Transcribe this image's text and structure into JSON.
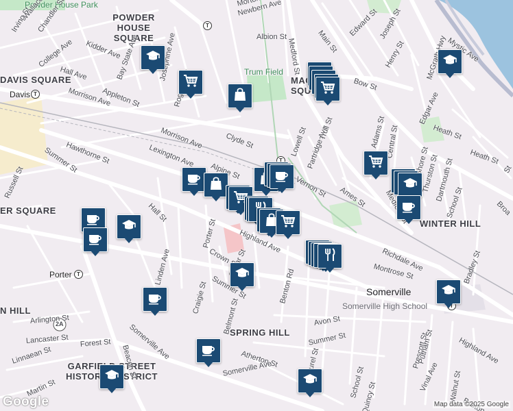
{
  "map": {
    "areas": [
      {
        "key": "powder-house-square",
        "text": "POWDER HOUSE SQUARE"
      },
      {
        "key": "davis-square",
        "text": "DAVIS SQUARE"
      },
      {
        "key": "union-square-partial",
        "text": "ER SQUARE"
      },
      {
        "key": "winter-hill",
        "text": "WINTER HILL"
      },
      {
        "key": "spring-hill",
        "text": "SPRING HILL"
      },
      {
        "key": "garfield",
        "text": "GARFIELD STREET HISTORIC DISTRICT"
      },
      {
        "key": "magoun-square",
        "text": "MAGOUN SQUARE"
      },
      {
        "key": "n-hill",
        "text": "N HILL"
      }
    ],
    "parks": [
      {
        "key": "powder-house-park",
        "text": "Powder House Park"
      },
      {
        "key": "trum-field",
        "text": "Trum Field"
      }
    ],
    "places": [
      {
        "key": "somerville",
        "text": "Somerville"
      },
      {
        "key": "somerville-high-school",
        "text": "Somerville High School"
      },
      {
        "key": "davis",
        "text": "Davis"
      },
      {
        "key": "porter",
        "text": "Porter"
      }
    ],
    "streets": [
      {
        "key": "irving",
        "text": "Irving St"
      },
      {
        "key": "chandler",
        "text": "Chandler St"
      },
      {
        "key": "wallace",
        "text": "Wallace St"
      },
      {
        "key": "college",
        "text": "College Ave"
      },
      {
        "key": "hall-ave",
        "text": "Hall Ave"
      },
      {
        "key": "kidder",
        "text": "Kidder Ave"
      },
      {
        "key": "bay-state",
        "text": "Bay State Ave"
      },
      {
        "key": "josephine",
        "text": "Josephine Ave"
      },
      {
        "key": "rogers",
        "text": "Rogers Ave"
      },
      {
        "key": "morrison-1",
        "text": "Morrison Ave"
      },
      {
        "key": "appleton",
        "text": "Appleton St"
      },
      {
        "key": "morrison-2",
        "text": "Morrison Ave"
      },
      {
        "key": "clyde",
        "text": "Clyde St"
      },
      {
        "key": "hawthorne",
        "text": "Hawthorne St"
      },
      {
        "key": "lexington",
        "text": "Lexington Ave"
      },
      {
        "key": "alpine",
        "text": "Alpine St"
      },
      {
        "key": "summer-1",
        "text": "Summer St"
      },
      {
        "key": "russell",
        "text": "Russell St"
      },
      {
        "key": "hall-st",
        "text": "Hall St"
      },
      {
        "key": "porter-st",
        "text": "Porter St"
      },
      {
        "key": "linden",
        "text": "Linden Ave"
      },
      {
        "key": "highland-1",
        "text": "Highland Ave"
      },
      {
        "key": "crown",
        "text": "Crown St"
      },
      {
        "key": "cedar",
        "text": "Cedar St"
      },
      {
        "key": "summer-2",
        "text": "Summer St"
      },
      {
        "key": "craigie",
        "text": "Craigie St"
      },
      {
        "key": "belmont",
        "text": "Belmont St"
      },
      {
        "key": "arlington",
        "text": "Arlington St"
      },
      {
        "key": "lancaster",
        "text": "Lancaster St"
      },
      {
        "key": "forest",
        "text": "Forest St"
      },
      {
        "key": "linnaean",
        "text": "Linnaean St"
      },
      {
        "key": "martin",
        "text": "Martin St"
      },
      {
        "key": "somerville-ave-1",
        "text": "Somerville Ave"
      },
      {
        "key": "beacon",
        "text": "Beacon St"
      },
      {
        "key": "atherton",
        "text": "Atherton St"
      },
      {
        "key": "somerville-ave-2",
        "text": "Somerville Ave"
      },
      {
        "key": "summer-3",
        "text": "Summer St"
      },
      {
        "key": "avon",
        "text": "Avon St"
      },
      {
        "key": "laurel",
        "text": "Laurel St"
      },
      {
        "key": "school-1",
        "text": "School St"
      },
      {
        "key": "quincy",
        "text": "Quincy St"
      },
      {
        "key": "benton",
        "text": "Benton Rd"
      },
      {
        "key": "montrose",
        "text": "Montrose St"
      },
      {
        "key": "richdale",
        "text": "Richdale Ave"
      },
      {
        "key": "prescott",
        "text": "Prescott St"
      },
      {
        "key": "putnam",
        "text": "Putnam St"
      },
      {
        "key": "vinal",
        "text": "Vinal Ave"
      },
      {
        "key": "walnut",
        "text": "Walnut St"
      },
      {
        "key": "boston",
        "text": "Boston St"
      },
      {
        "key": "highland-2",
        "text": "Highland Ave"
      },
      {
        "key": "bradley",
        "text": "Bradley St"
      },
      {
        "key": "school-2",
        "text": "School St"
      },
      {
        "key": "dartmouth",
        "text": "Dartmouth St"
      },
      {
        "key": "thurston",
        "text": "Thurston St"
      },
      {
        "key": "shore",
        "text": "Shore St"
      },
      {
        "key": "central",
        "text": "Central St"
      },
      {
        "key": "adams",
        "text": "Adams St"
      },
      {
        "key": "medford-1",
        "text": "Medford St"
      },
      {
        "key": "ames",
        "text": "Ames St"
      },
      {
        "key": "vernon",
        "text": "Vernon St"
      },
      {
        "key": "partridge",
        "text": "Partridge Ave"
      },
      {
        "key": "trull",
        "text": "Trull St"
      },
      {
        "key": "lowell",
        "text": "Lowell St"
      },
      {
        "key": "bow",
        "text": "Bow St"
      },
      {
        "key": "henry",
        "text": "Henry St"
      },
      {
        "key": "joseph",
        "text": "Joseph St"
      },
      {
        "key": "edward",
        "text": "Edward St"
      },
      {
        "key": "main",
        "text": "Main St"
      },
      {
        "key": "medford-2",
        "text": "Medford St"
      },
      {
        "key": "albion",
        "text": "Albion St"
      },
      {
        "key": "newbern",
        "text": "Newbern Ave"
      },
      {
        "key": "morton",
        "text": "Morton St"
      },
      {
        "key": "mystic",
        "text": "Mystic Ave"
      },
      {
        "key": "mcgrath",
        "text": "McGrath Hwy"
      },
      {
        "key": "edgar",
        "text": "Edgar Ave"
      },
      {
        "key": "heath-1",
        "text": "Heath St"
      },
      {
        "key": "heath-2",
        "text": "Heath St"
      },
      {
        "key": "broadway",
        "text": "Broa"
      },
      {
        "key": "st-edge",
        "text": "St"
      },
      {
        "key": "route-2a",
        "text": "2A"
      }
    ],
    "pins": [
      {
        "key": "school-1",
        "type": "school-icon"
      },
      {
        "key": "grocery-1",
        "type": "cart-icon"
      },
      {
        "key": "shop-1",
        "type": "bag-icon"
      },
      {
        "key": "grocery-cluster-magoun",
        "type": "cart-icon"
      },
      {
        "key": "school-2",
        "type": "school-icon"
      },
      {
        "key": "coffee-1",
        "type": "coffee-icon"
      },
      {
        "key": "shop-2",
        "type": "bag-icon"
      },
      {
        "key": "shop-3",
        "type": "bag-icon"
      },
      {
        "key": "coffee-2",
        "type": "coffee-icon"
      },
      {
        "key": "grocery-2",
        "type": "cart-icon"
      },
      {
        "key": "restaurant-1",
        "type": "restaurant-icon"
      },
      {
        "key": "shop-4",
        "type": "bag-icon"
      },
      {
        "key": "grocery-3",
        "type": "cart-icon"
      },
      {
        "key": "coffee-3",
        "type": "coffee-icon"
      },
      {
        "key": "school-3",
        "type": "school-icon"
      },
      {
        "key": "coffee-4",
        "type": "coffee-icon"
      },
      {
        "key": "restaurant-2",
        "type": "restaurant-icon"
      },
      {
        "key": "school-4",
        "type": "school-icon"
      },
      {
        "key": "coffee-5",
        "type": "coffee-icon"
      },
      {
        "key": "grocery-4",
        "type": "cart-icon"
      },
      {
        "key": "school-5",
        "type": "school-icon"
      },
      {
        "key": "coffee-6",
        "type": "coffee-icon"
      },
      {
        "key": "school-6",
        "type": "school-icon"
      },
      {
        "key": "coffee-7",
        "type": "coffee-icon"
      },
      {
        "key": "school-7",
        "type": "school-icon"
      },
      {
        "key": "school-8",
        "type": "school-icon"
      }
    ],
    "logo": "Google",
    "attribution": "Map data ©2025 Google",
    "transit_symbol": "T"
  }
}
